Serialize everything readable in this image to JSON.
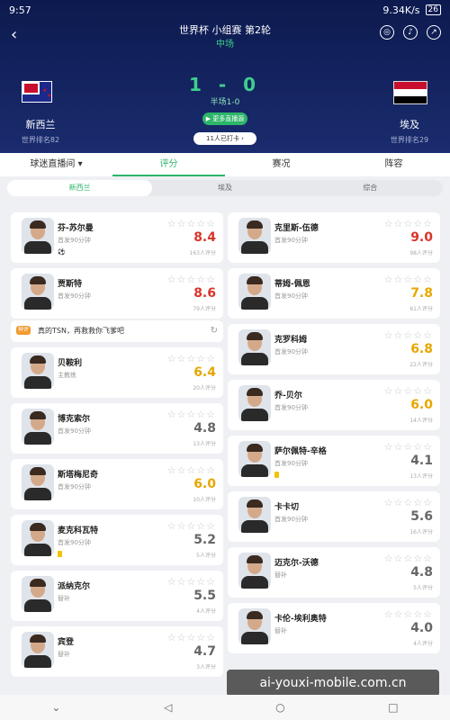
{
  "status": {
    "time": "9:57",
    "net": "9.34K/s",
    "battery": "26"
  },
  "header": {
    "title": "世界杯 小组赛 第2轮",
    "stage": "中场",
    "score": "1 - 0",
    "halftime": "半场1-0",
    "live_button": "▶ 更多直播源",
    "checkin": "11人已打卡 ›"
  },
  "teams": {
    "home": {
      "name": "新西兰",
      "rank": "世界排名82"
    },
    "away": {
      "name": "埃及",
      "rank": "世界排名29"
    }
  },
  "tabs": [
    "球迷直播间 ▾",
    "评分",
    "赛况",
    "阵容"
  ],
  "subtabs": [
    "新西兰",
    "埃及",
    "综合"
  ],
  "colors": {
    "accent": "#2db56a",
    "header_bg": "#0d1a4f",
    "red": "#d9342b",
    "yellow": "#e6a700"
  },
  "left_players": [
    {
      "name": "芬-苏尔曼",
      "info": "首发90分钟",
      "rating": "8.4",
      "votes": "163人评分",
      "tag": "⚽",
      "color": "red"
    },
    {
      "name": "贾斯特",
      "info": "首发90分钟",
      "rating": "8.6",
      "votes": "79人评分",
      "tag": "",
      "color": "red"
    },
    {
      "name": "贝鞍利",
      "info": "主教练",
      "rating": "6.4",
      "votes": "20人评分",
      "tag": "",
      "color": "yellow"
    },
    {
      "name": "博克索尔",
      "info": "首发90分钟",
      "rating": "4.8",
      "votes": "13人评分",
      "tag": "",
      "color": "gray"
    },
    {
      "name": "斯塔梅尼奇",
      "info": "首发90分钟",
      "rating": "6.0",
      "votes": "10人评分",
      "tag": "",
      "color": "yellow"
    },
    {
      "name": "麦克科瓦特",
      "info": "首发90分钟",
      "rating": "5.2",
      "votes": "5人评分",
      "tag": "yellow",
      "color": "gray"
    },
    {
      "name": "派纳克尔",
      "info": "替补",
      "rating": "5.5",
      "votes": "4人评分",
      "tag": "",
      "color": "gray"
    },
    {
      "name": "宾登",
      "info": "替补",
      "rating": "4.7",
      "votes": "3人评分",
      "tag": "",
      "color": "gray"
    }
  ],
  "comment": {
    "badge": "神评",
    "text": "真的TSN，再救救你飞爹吧"
  },
  "right_players": [
    {
      "name": "克里斯-伍德",
      "info": "首发90分钟",
      "rating": "9.0",
      "votes": "98人评分",
      "tag": "",
      "color": "red"
    },
    {
      "name": "蒂姆-佩恩",
      "info": "首发90分钟",
      "rating": "7.8",
      "votes": "61人评分",
      "tag": "",
      "color": "yellow"
    },
    {
      "name": "克罗科姆",
      "info": "首发90分钟",
      "rating": "6.8",
      "votes": "22人评分",
      "tag": "",
      "color": "yellow"
    },
    {
      "name": "乔-贝尔",
      "info": "首发90分钟",
      "rating": "6.0",
      "votes": "14人评分",
      "tag": "",
      "color": "yellow"
    },
    {
      "name": "萨尔佩特-辛格",
      "info": "首发90分钟",
      "rating": "4.1",
      "votes": "13人评分",
      "tag": "yellow",
      "color": "gray"
    },
    {
      "name": "卡卡切",
      "info": "首发90分钟",
      "rating": "5.6",
      "votes": "16人评分",
      "tag": "",
      "color": "gray"
    },
    {
      "name": "迈克尔-沃德",
      "info": "替补",
      "rating": "4.8",
      "votes": "5人评分",
      "tag": "",
      "color": "gray"
    },
    {
      "name": "卡伦-埃利奥特",
      "info": "替补",
      "rating": "4.0",
      "votes": "4人评分",
      "tag": "",
      "color": "gray"
    }
  ],
  "watermark": "ai-youxi-mobile.com.cn"
}
